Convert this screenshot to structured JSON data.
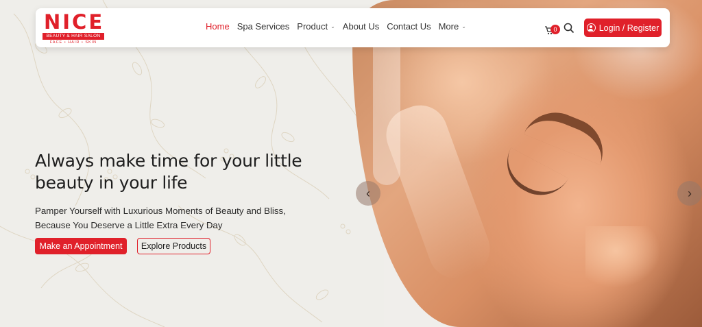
{
  "brand": {
    "name": "NICE",
    "tagline": "BEAUTY & HAIR SALON",
    "subline": "FACE • HAIR • SKIN",
    "accent_color": "#e0202a"
  },
  "nav": {
    "items": [
      {
        "label": "Home",
        "active": true
      },
      {
        "label": "Spa Services"
      },
      {
        "label": "Product",
        "dropdown": true
      },
      {
        "label": "About Us"
      },
      {
        "label": "Contact Us"
      },
      {
        "label": "More",
        "dropdown": true
      }
    ]
  },
  "header": {
    "cart_count": "0",
    "login_label": "Login / Register"
  },
  "hero": {
    "headline_line1": "Always make time for your little",
    "headline_line2": "beauty in your life",
    "subtext_line1": "Pamper Yourself with Luxurious Moments of Beauty and Bliss,",
    "subtext_line2": "Because You Deserve a Little Extra Every Day",
    "primary_cta": "Make an Appointment",
    "secondary_cta": "Explore Products"
  },
  "carousel": {
    "prev_glyph": "‹",
    "next_glyph": "›"
  }
}
